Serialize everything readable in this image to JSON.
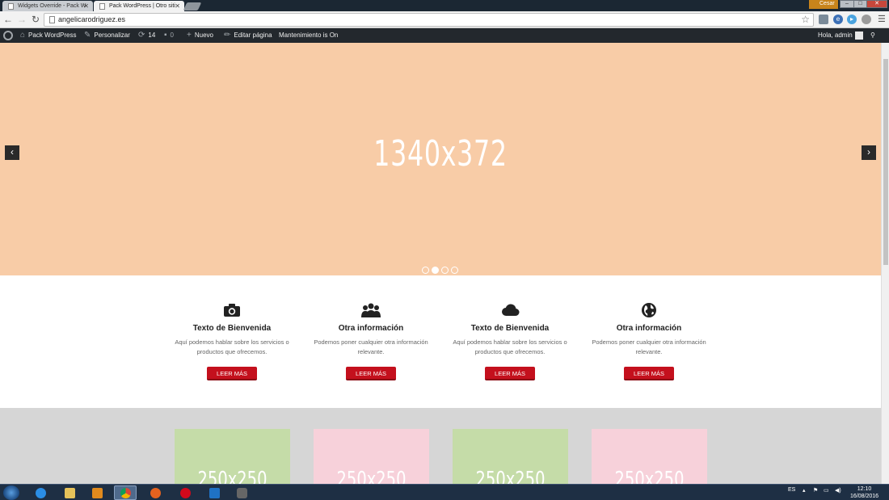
{
  "browser": {
    "tabs": [
      {
        "label": "Widgets Override - Pack W",
        "active": false
      },
      {
        "label": "Pack WordPress | Otro siti",
        "active": true
      }
    ],
    "user_label": "Cesar",
    "url": "angelicarodriguez.es"
  },
  "adminbar": {
    "site": "Pack WordPress",
    "customize": "Personalizar",
    "updates": "14",
    "comments": "0",
    "new": "Nuevo",
    "edit": "Editar página",
    "maintenance": "Mantenimiento is On",
    "greeting": "Hola, admin"
  },
  "hero": {
    "placeholder": "1340x372",
    "prev_icon": "‹",
    "next_icon": "›",
    "slides": 4,
    "active_slide": 2,
    "bg_color": "#f8cca7"
  },
  "features": [
    {
      "icon": "camera-icon",
      "title": "Texto de Bienvenida",
      "text": "Aquí podemos hablar sobre los servicios o productos que ofrecemos.",
      "button": "LEER MÁS"
    },
    {
      "icon": "users-icon",
      "title": "Otra información",
      "text": "Podemos poner cualquier otra información relevante.",
      "button": "LEER MÁS"
    },
    {
      "icon": "cloud-icon",
      "title": "Texto de Bienvenida",
      "text": "Aquí podemos hablar sobre los servicios o productos que ofrecemos.",
      "button": "LEER MÁS"
    },
    {
      "icon": "globe-icon",
      "title": "Otra información",
      "text": "Podemos poner cualquier otra información relevante.",
      "button": "LEER MÁS"
    }
  ],
  "gallery": {
    "tiles": [
      {
        "label": "250x250",
        "color": "#c5dca8"
      },
      {
        "label": "250x250",
        "color": "#f7d1da"
      },
      {
        "label": "250x250",
        "color": "#c5dca8"
      },
      {
        "label": "250x250",
        "color": "#f7d1da"
      }
    ]
  },
  "taskbar": {
    "language": "ES",
    "time": "12:10",
    "date": "16/08/2016"
  },
  "colors": {
    "accent_button": "#c4101d",
    "adminbar": "#23282d",
    "taskbar": "#1e2f44"
  }
}
